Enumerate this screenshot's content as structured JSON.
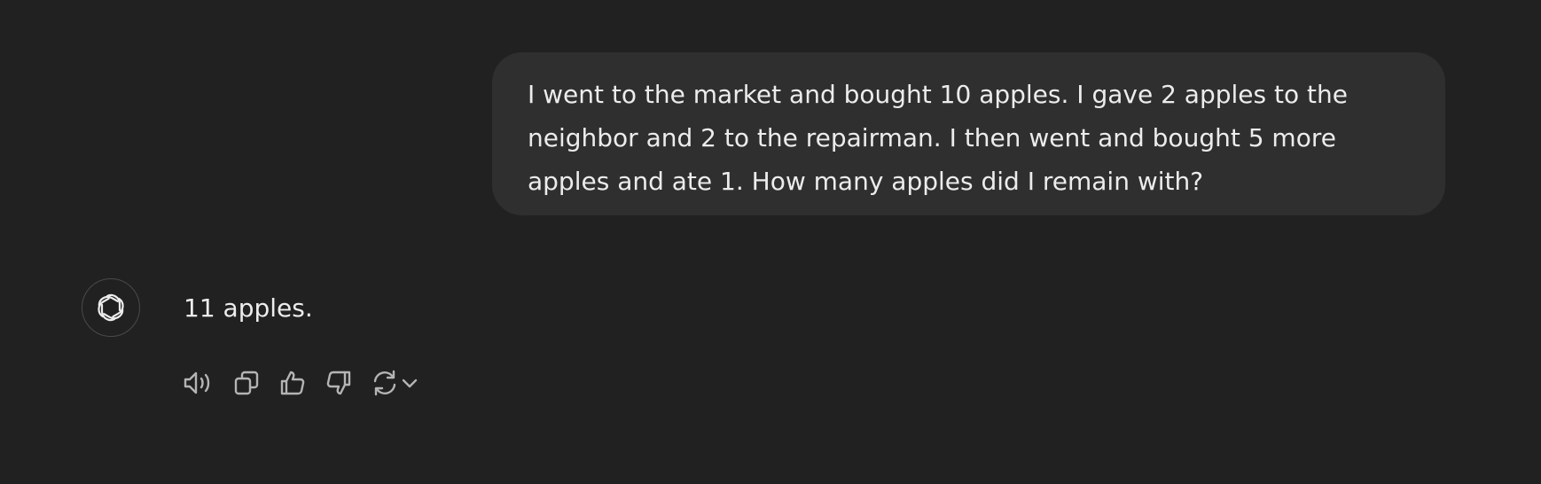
{
  "conversation": {
    "user_message": "I went to the market and bought 10 apples. I gave 2 apples to the neighbor and 2 to the repairman. I then went and bought 5 more apples and ate 1. How many apples did I remain with?",
    "assistant_message": "11 apples."
  },
  "assistant": {
    "avatar_icon": "openai-logo-icon"
  },
  "actions": {
    "icons": [
      "read-aloud-icon",
      "copy-icon",
      "thumbs-up-icon",
      "thumbs-down-icon",
      "regenerate-icon",
      "chevron-down-icon"
    ]
  },
  "colors": {
    "background": "#212121",
    "user_bubble": "#2f2f2f",
    "text": "#ececec",
    "icon": "#b4b4b4"
  }
}
